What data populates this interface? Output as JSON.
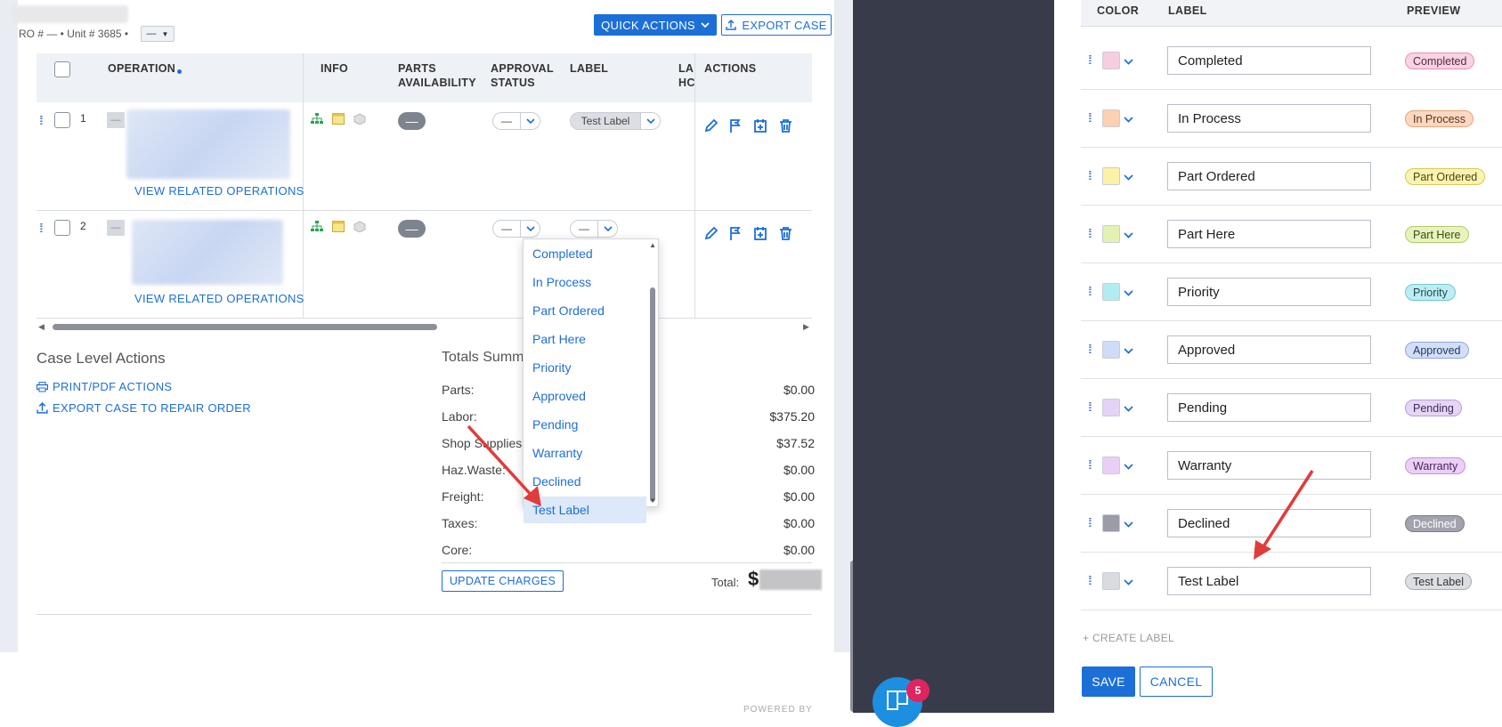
{
  "header": {
    "ro_line": "RO # — • Unit # 3685 •",
    "ro_select": "—",
    "quick_actions_label": "QUICK ACTIONS",
    "export_case_label": "EXPORT CASE"
  },
  "table": {
    "headers": {
      "operation": "OPERATION",
      "info": "INFO",
      "parts_availability_1": "PARTS",
      "parts_availability_2": "AVAILABILITY",
      "approval_status_1": "APPROVAL",
      "approval_status_2": "STATUS",
      "label": "LABEL",
      "labor_hours_1": "LA",
      "labor_hours_2": "HC",
      "actions": "ACTIONS"
    },
    "rows": [
      {
        "num": "1",
        "collapse": "—",
        "parts": "—",
        "approval": "—",
        "label": "Test Label",
        "related": "VIEW RELATED OPERATIONS"
      },
      {
        "num": "2",
        "collapse": "—",
        "parts": "—",
        "approval": "—",
        "label": "—",
        "related": "VIEW RELATED OPERATIONS"
      }
    ]
  },
  "label_dropdown": {
    "options": [
      "Completed",
      "In Process",
      "Part Ordered",
      "Part Here",
      "Priority",
      "Approved",
      "Pending",
      "Warranty",
      "Declined",
      "Test Label"
    ],
    "selected": "Test Label"
  },
  "case_actions": {
    "title": "Case Level Actions",
    "print_label": "PRINT/PDF ACTIONS",
    "export_label": "EXPORT CASE TO REPAIR ORDER"
  },
  "totals": {
    "title": "Totals Summary",
    "lines": [
      {
        "label": "Parts:",
        "value": "$0.00"
      },
      {
        "label": "Labor:",
        "value": "$375.20"
      },
      {
        "label": "Shop Supplies:",
        "value": "$37.52"
      },
      {
        "label": "Haz.Waste:",
        "value": "$0.00"
      },
      {
        "label": "Freight:",
        "value": "$0.00"
      },
      {
        "label": "Taxes:",
        "value": "$0.00"
      },
      {
        "label": "Core:",
        "value": "$0.00"
      }
    ],
    "update_label": "UPDATE CHARGES",
    "total_label": "Total:",
    "total_currency": "$"
  },
  "footer": {
    "powered_by": "POWERED BY"
  },
  "middle": {
    "badge_count": "5"
  },
  "label_editor": {
    "headers": {
      "color": "COLOR",
      "label": "LABEL",
      "preview": "PREVIEW"
    },
    "rows": [
      {
        "label": "Completed",
        "swatch": "#f7cde0",
        "pill_bg": "#f9d3e3",
        "pill_border": "#e58fb4",
        "pill_text": "#5a2a3e"
      },
      {
        "label": "In Process",
        "swatch": "#fbd0b3",
        "pill_bg": "#fcd8c1",
        "pill_border": "#e9a27a",
        "pill_text": "#5a3420"
      },
      {
        "label": "Part Ordered",
        "swatch": "#fbf2a8",
        "pill_bg": "#fbf3b1",
        "pill_border": "#d9c955",
        "pill_text": "#4d4510"
      },
      {
        "label": "Part Here",
        "swatch": "#e3f1b5",
        "pill_bg": "#e6f3bc",
        "pill_border": "#b3cd69",
        "pill_text": "#3d4a17"
      },
      {
        "label": "Priority",
        "swatch": "#b3ecf0",
        "pill_bg": "#bcedf2",
        "pill_border": "#6dc9d3",
        "pill_text": "#1d4a50"
      },
      {
        "label": "Approved",
        "swatch": "#cfdcf7",
        "pill_bg": "#d3def7",
        "pill_border": "#8ea8de",
        "pill_text": "#233a66"
      },
      {
        "label": "Pending",
        "swatch": "#e4d3f5",
        "pill_bg": "#e5d6f5",
        "pill_border": "#b89ddf",
        "pill_text": "#3e2a5c"
      },
      {
        "label": "Warranty",
        "swatch": "#e9cff5",
        "pill_bg": "#eccff6",
        "pill_border": "#c690dd",
        "pill_text": "#4a2358"
      },
      {
        "label": "Declined",
        "swatch": "#9c9ca8",
        "pill_bg": "#a2a3ad",
        "pill_border": "#7c7d87",
        "pill_text": "#ffffff"
      },
      {
        "label": "Test Label",
        "swatch": "#d9dbe1",
        "pill_bg": "#dcdee3",
        "pill_border": "#a7abb4",
        "pill_text": "#333333"
      }
    ],
    "create_label": "+ CREATE LABEL",
    "save_label": "SAVE",
    "cancel_label": "CANCEL"
  },
  "colors": {
    "accent": "#1d6fd8",
    "middle_bg": "#383c4a",
    "badge": "#e0245e",
    "arrow": "#e23b3b"
  }
}
